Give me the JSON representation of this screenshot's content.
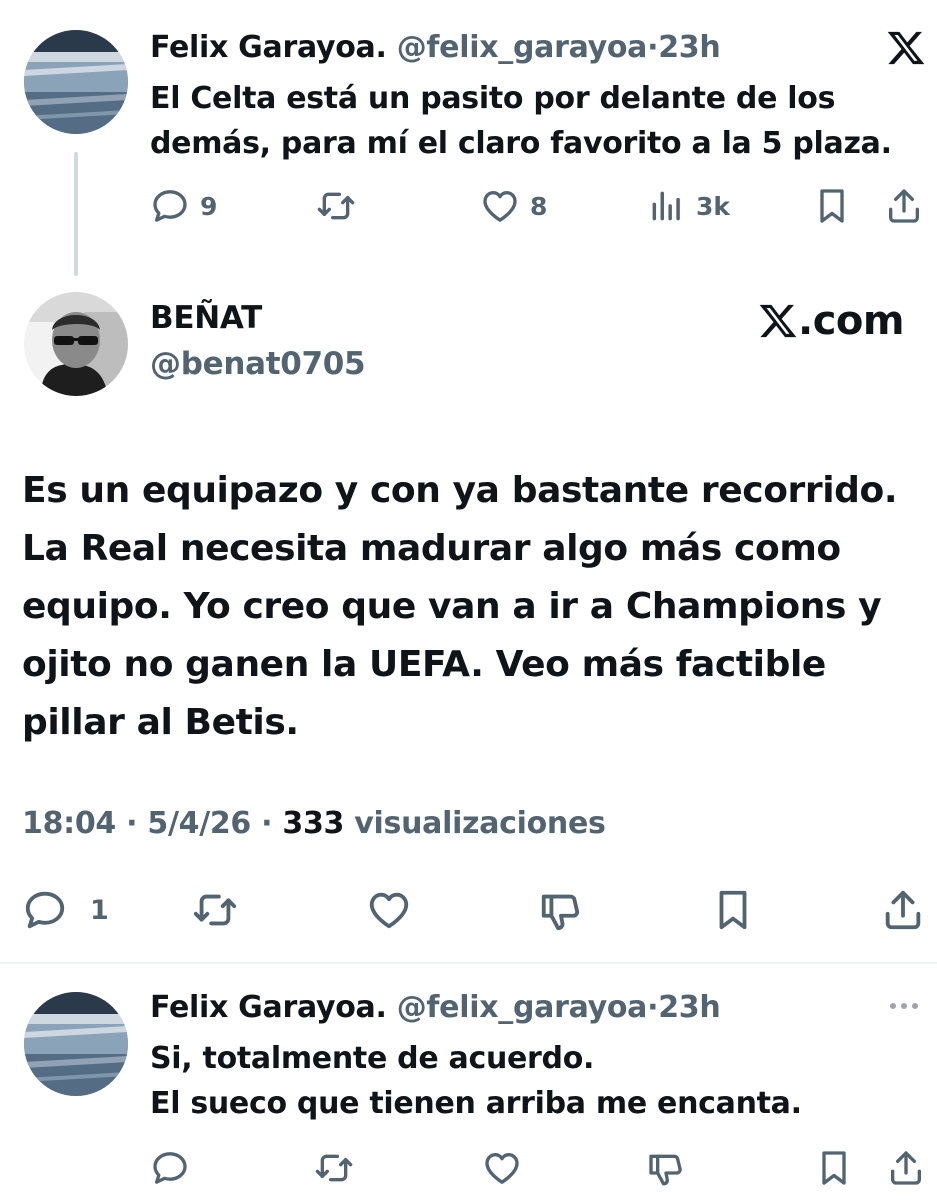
{
  "reply1": {
    "name": "Felix Garayoa.",
    "handle": "@felix_garayoa",
    "separator": "·",
    "time": "23h",
    "lines": [
      "El Celta está un pasito por delante de los",
      "demás, para mí el claro favorito a la 5 plaza."
    ],
    "actions": {
      "replies": "9",
      "likes": "8",
      "views": "3k"
    },
    "icons": [
      "reply-icon",
      "retweet-icon",
      "like-icon",
      "views-icon",
      "bookmark-icon",
      "share-icon",
      "x-logo-icon"
    ]
  },
  "main": {
    "name": "BEÑAT",
    "handle": "@benat0705",
    "watermark": "X.com",
    "watermark_suffix": ".com",
    "lines": [
      "Es un equipazo y con ya bastante recorrido.",
      "La Real necesita madurar algo más como",
      "equipo. Yo creo que van a ir a Champions y",
      "ojito no ganen la UEFA. Veo más factible",
      "pillar al Betis."
    ],
    "meta": {
      "time": "18:04",
      "sep1": " · ",
      "date": "5/4/26",
      "sep2": " · ",
      "views_count": "333",
      "views_label": " visualizaciones"
    },
    "actions": {
      "replies": "1"
    },
    "icons": [
      "reply-icon",
      "retweet-icon",
      "like-icon",
      "dislike-icon",
      "bookmark-icon",
      "share-icon"
    ]
  },
  "reply2": {
    "name": "Felix Garayoa.",
    "handle": "@felix_garayoa",
    "separator": "·",
    "time": "23h",
    "lines": [
      "Si, totalmente de acuerdo.",
      "El sueco que tienen arriba me encanta."
    ],
    "icons": [
      "reply-icon",
      "retweet-icon",
      "like-icon",
      "dislike-icon",
      "bookmark-icon",
      "share-icon",
      "more-icon"
    ]
  },
  "colors": {
    "text": "#0f1419",
    "secondary": "#536471",
    "thread_line": "#cfd9de",
    "divider": "#eff3f4"
  }
}
